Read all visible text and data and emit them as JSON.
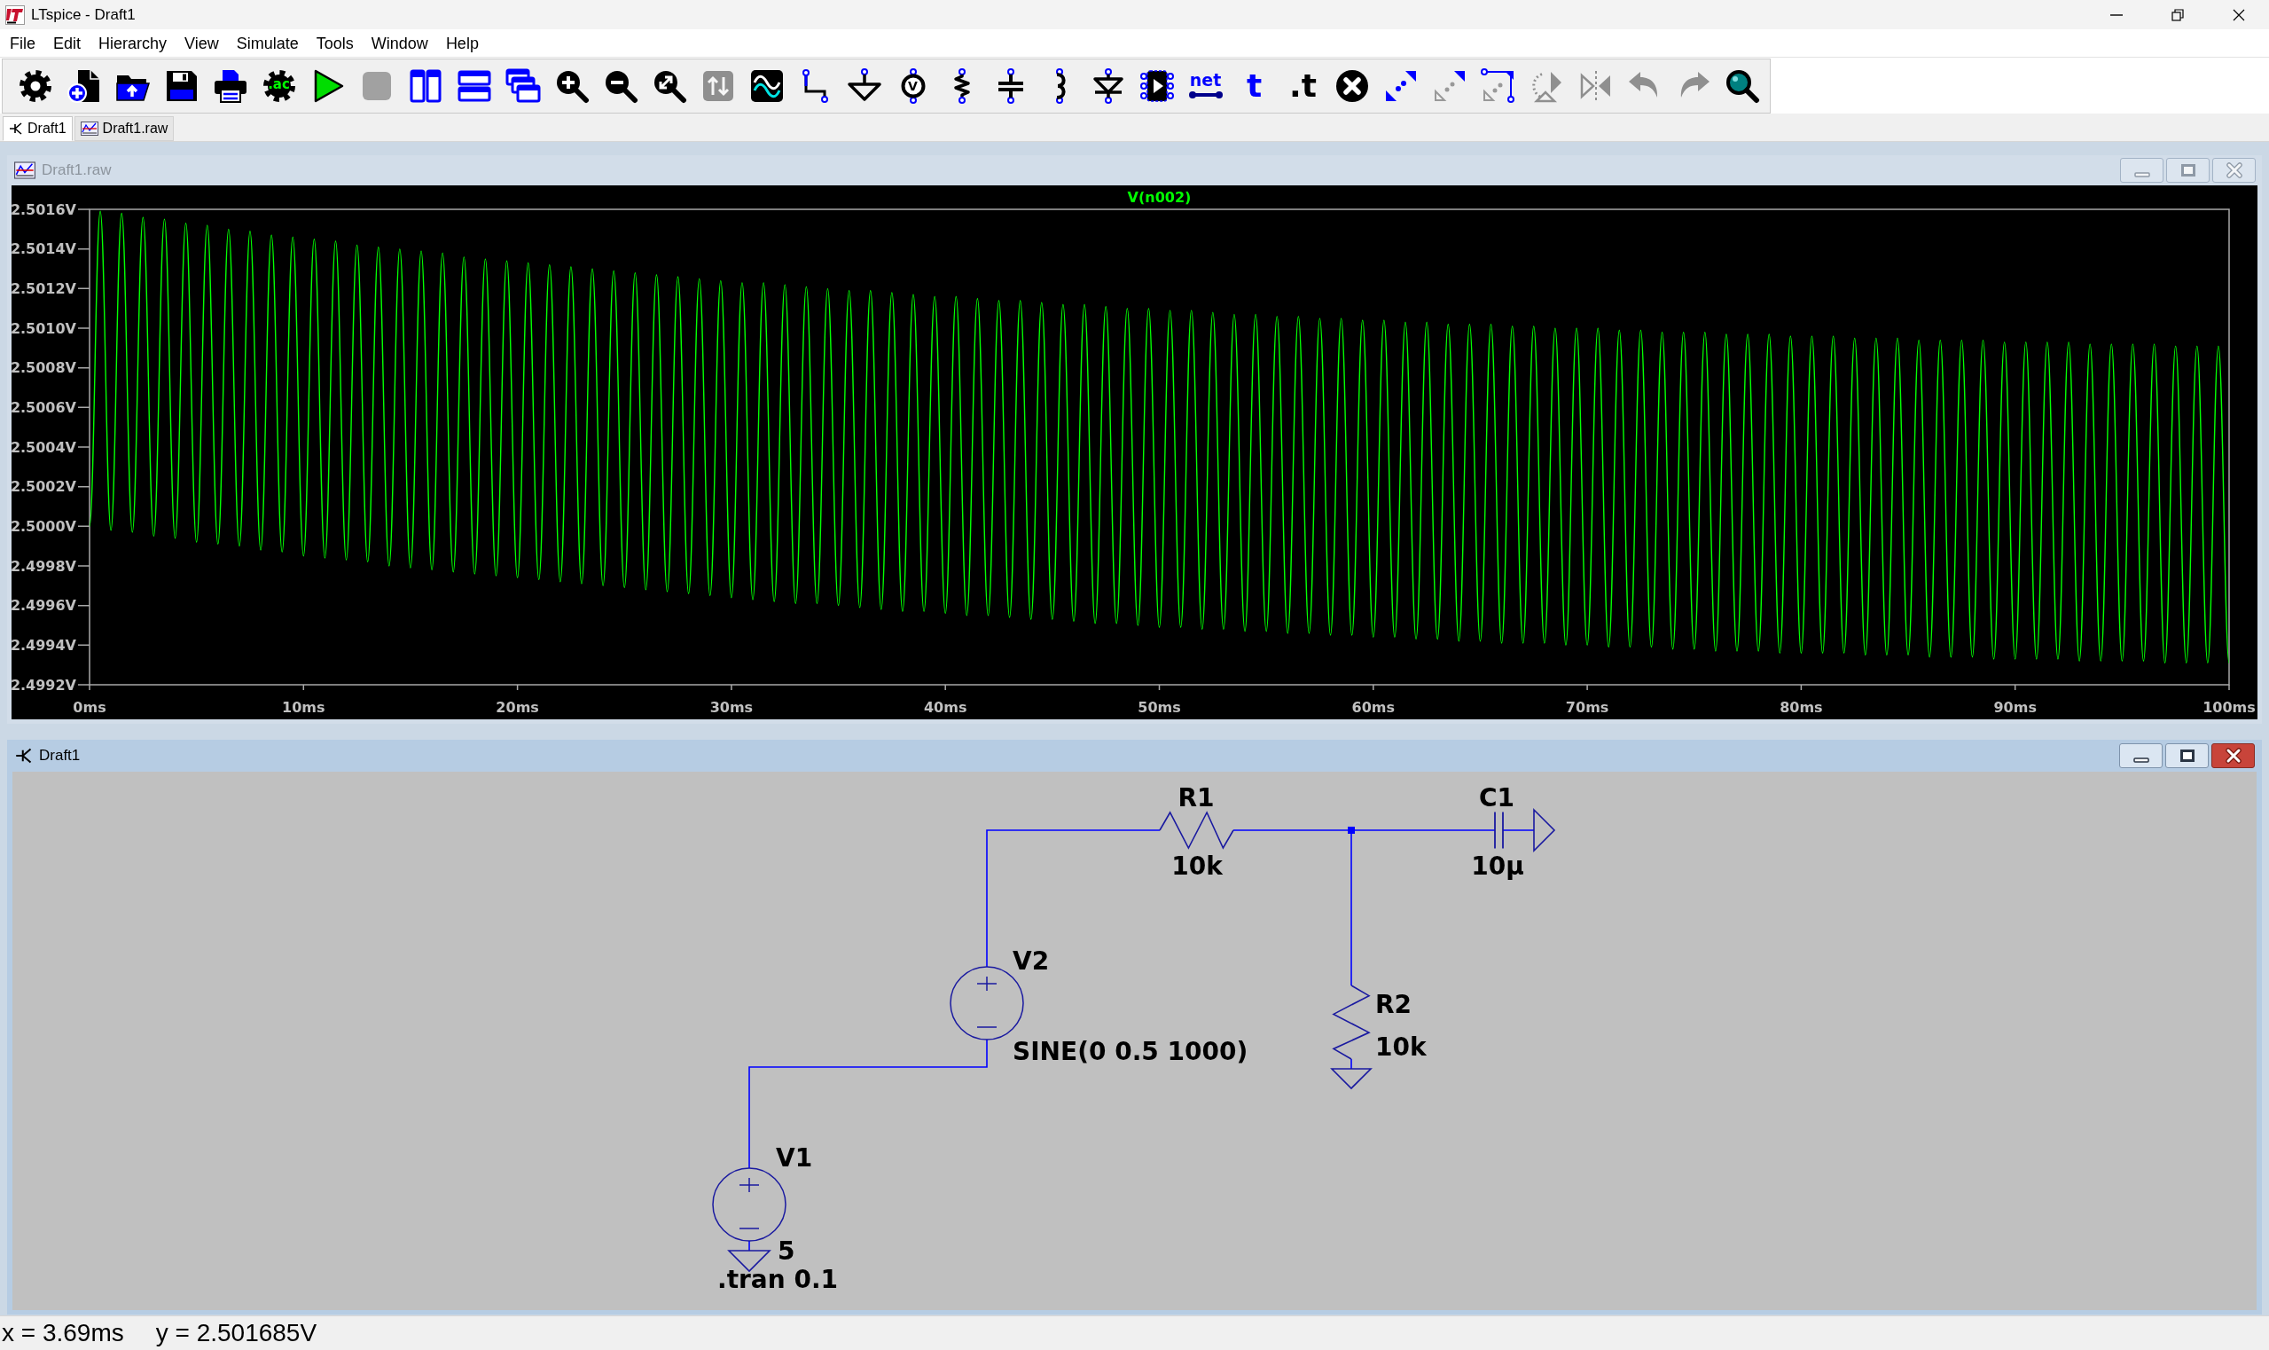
{
  "window": {
    "title": "LTspice - Draft1"
  },
  "menu": [
    "File",
    "Edit",
    "Hierarchy",
    "View",
    "Simulate",
    "Tools",
    "Window",
    "Help"
  ],
  "toolbar": [
    {
      "kind": "settings",
      "disabled": false
    },
    {
      "kind": "new",
      "disabled": false
    },
    {
      "kind": "open",
      "disabled": false
    },
    {
      "kind": "save",
      "disabled": false
    },
    {
      "kind": "print",
      "disabled": false
    },
    {
      "kind": "ac",
      "text": ".ac",
      "disabled": false
    },
    {
      "kind": "run",
      "disabled": false
    },
    {
      "kind": "stop",
      "disabled": true
    },
    {
      "kind": "tile_columns",
      "disabled": false
    },
    {
      "kind": "tile_rows",
      "disabled": false
    },
    {
      "kind": "cascade",
      "disabled": false
    },
    {
      "kind": "zoom_in",
      "disabled": false
    },
    {
      "kind": "zoom_out",
      "disabled": false
    },
    {
      "kind": "zoom_fit",
      "disabled": false
    },
    {
      "kind": "pan",
      "disabled": true
    },
    {
      "kind": "waveform",
      "disabled": false
    },
    {
      "kind": "wire",
      "disabled": false
    },
    {
      "kind": "ground",
      "disabled": false
    },
    {
      "kind": "voltage_source",
      "text": "V",
      "disabled": false
    },
    {
      "kind": "resistor",
      "disabled": false
    },
    {
      "kind": "capacitor",
      "disabled": false
    },
    {
      "kind": "inductor",
      "disabled": false
    },
    {
      "kind": "diode",
      "disabled": false
    },
    {
      "kind": "component",
      "disabled": false
    },
    {
      "kind": "net",
      "text": "net",
      "disabled": false
    },
    {
      "kind": "text",
      "text": "t",
      "disabled": false
    },
    {
      "kind": "spice",
      "text": ".t",
      "disabled": false
    },
    {
      "kind": "delete",
      "disabled": false
    },
    {
      "kind": "copy",
      "disabled": false
    },
    {
      "kind": "move",
      "disabled": false
    },
    {
      "kind": "drag",
      "disabled": false
    },
    {
      "kind": "rotate",
      "disabled": true
    },
    {
      "kind": "mirror",
      "disabled": true
    },
    {
      "kind": "undo",
      "disabled": true
    },
    {
      "kind": "redo",
      "disabled": true
    },
    {
      "kind": "find",
      "disabled": false
    }
  ],
  "tabs": [
    {
      "label": "Draft1",
      "kind": "schematic",
      "selected": true
    },
    {
      "label": "Draft1.raw",
      "kind": "waveform",
      "selected": false
    }
  ],
  "plot_window": {
    "title": "Draft1.raw",
    "active": false,
    "chart_data": {
      "type": "line",
      "xlim": [
        0,
        100
      ],
      "ylim": [
        2.4992,
        2.5016
      ],
      "xticks": [
        {
          "value": 0,
          "label": "0ms"
        },
        {
          "value": 10,
          "label": "10ms"
        },
        {
          "value": 20,
          "label": "20ms"
        },
        {
          "value": 30,
          "label": "30ms"
        },
        {
          "value": 40,
          "label": "40ms"
        },
        {
          "value": 50,
          "label": "50ms"
        },
        {
          "value": 60,
          "label": "60ms"
        },
        {
          "value": 70,
          "label": "70ms"
        },
        {
          "value": 80,
          "label": "80ms"
        },
        {
          "value": 90,
          "label": "90ms"
        },
        {
          "value": 100,
          "label": "100ms"
        }
      ],
      "yticks": [
        {
          "value": 2.5016,
          "label": "2.5016V"
        },
        {
          "value": 2.5014,
          "label": "2.5014V"
        },
        {
          "value": 2.5012,
          "label": "2.5012V"
        },
        {
          "value": 2.501,
          "label": "2.5010V"
        },
        {
          "value": 2.5008,
          "label": "2.5008V"
        },
        {
          "value": 2.5006,
          "label": "2.5006V"
        },
        {
          "value": 2.5004,
          "label": "2.5004V"
        },
        {
          "value": 2.5002,
          "label": "2.5002V"
        },
        {
          "value": 2.5,
          "label": "2.5000V"
        },
        {
          "value": 2.4998,
          "label": "2.4998V"
        },
        {
          "value": 2.4996,
          "label": "2.4996V"
        },
        {
          "value": 2.4994,
          "label": "2.4994V"
        },
        {
          "value": 2.4992,
          "label": "2.4992V"
        }
      ],
      "x": [
        0,
        0.5,
        1,
        1.5,
        2,
        2.5,
        3,
        3.5,
        4,
        4.5,
        5,
        5.5,
        6,
        6.5,
        7,
        7.5,
        8,
        8.5,
        9,
        9.5,
        10,
        10.5,
        11,
        11.5,
        12,
        12.5,
        13,
        13.5,
        14,
        14.5,
        15,
        15.5,
        16,
        16.5,
        17,
        17.5,
        18,
        18.5,
        19,
        19.5,
        20,
        20.5,
        21,
        21.5,
        22,
        22.5,
        23,
        23.5,
        24,
        24.5,
        25,
        25.5,
        26,
        26.5,
        27,
        27.5,
        28,
        28.5,
        29,
        29.5,
        30,
        30.5,
        31,
        31.5,
        32,
        32.5,
        33,
        33.5,
        34,
        34.5,
        35,
        35.5,
        36,
        36.5,
        37,
        37.5,
        38,
        38.5,
        39,
        39.5,
        40,
        40.5,
        41,
        41.5,
        42,
        42.5,
        43,
        43.5,
        44,
        44.5,
        45,
        45.5,
        46,
        46.5,
        47,
        47.5,
        48,
        48.5,
        49,
        49.5,
        50,
        50.5,
        51,
        51.5,
        52,
        52.5,
        53,
        53.5,
        54,
        54.5,
        55,
        55.5,
        56,
        56.5,
        57,
        57.5,
        58,
        58.5,
        59,
        59.5,
        60,
        60.5,
        61,
        61.5,
        62,
        62.5,
        63,
        63.5,
        64,
        64.5,
        65,
        65.5,
        66,
        66.5,
        67,
        67.5,
        68,
        68.5,
        69,
        69.5,
        70,
        70.5,
        71,
        71.5,
        72,
        72.5,
        73,
        73.5,
        74,
        74.5,
        75,
        75.5,
        76,
        76.5,
        77,
        77.5,
        78,
        78.5,
        79,
        79.5,
        80,
        80.5,
        81,
        81.5,
        82,
        82.5,
        83,
        83.5,
        84,
        84.5,
        85,
        85.5,
        86,
        86.5,
        87,
        87.5,
        88,
        88.5,
        89,
        89.5,
        90,
        90.5,
        91,
        91.5,
        92,
        92.5,
        93,
        93.5,
        94,
        94.5,
        95,
        95.5,
        96,
        96.5,
        97,
        97.5,
        98,
        98.5,
        99,
        99.5,
        100
      ],
      "series": [
        {
          "name": "V(n002)",
          "color": "#00ff00",
          "values": [
            2.5,
            2.50159,
            2.49998,
            2.50158,
            2.49997,
            2.50156,
            2.49995,
            2.50155,
            2.49994,
            2.50153,
            2.49992,
            2.50152,
            2.49991,
            2.5015,
            2.4999,
            2.50149,
            2.49988,
            2.50147,
            2.49987,
            2.50146,
            2.49985,
            2.50145,
            2.49984,
            2.50144,
            2.49983,
            2.50142,
            2.49982,
            2.50141,
            2.4998,
            2.5014,
            2.49979,
            2.50139,
            2.49978,
            2.50138,
            2.49977,
            2.50136,
            2.49976,
            2.50135,
            2.49975,
            2.50134,
            2.49974,
            2.50133,
            2.49973,
            2.50132,
            2.49972,
            2.50131,
            2.49971,
            2.5013,
            2.4997,
            2.50129,
            2.49969,
            2.50128,
            2.49968,
            2.50127,
            2.49967,
            2.50126,
            2.49966,
            2.50125,
            2.49965,
            2.50124,
            2.49964,
            2.50123,
            2.49963,
            2.50123,
            2.49962,
            2.50122,
            2.49961,
            2.50121,
            2.49961,
            2.5012,
            2.4996,
            2.50119,
            2.49959,
            2.50119,
            2.49958,
            2.50118,
            2.49957,
            2.50117,
            2.49957,
            2.50116,
            2.49956,
            2.50116,
            2.49955,
            2.50115,
            2.49955,
            2.50114,
            2.49954,
            2.50114,
            2.49953,
            2.50113,
            2.49953,
            2.50112,
            2.49952,
            2.50112,
            2.49951,
            2.50111,
            2.49951,
            2.5011,
            2.4995,
            2.5011,
            2.49949,
            2.50109,
            2.49949,
            2.50109,
            2.49948,
            2.50108,
            2.49948,
            2.50107,
            2.49947,
            2.50107,
            2.49947,
            2.50106,
            2.49946,
            2.50106,
            2.49946,
            2.50105,
            2.49945,
            2.50105,
            2.49945,
            2.50104,
            2.49944,
            2.50104,
            2.49944,
            2.50103,
            2.49943,
            2.50103,
            2.49943,
            2.50102,
            2.49942,
            2.50102,
            2.49942,
            2.50102,
            2.49941,
            2.50101,
            2.49941,
            2.50101,
            2.49941,
            2.501,
            2.4994,
            2.501,
            2.4994,
            2.501,
            2.49939,
            2.50099,
            2.49939,
            2.50099,
            2.49939,
            2.50098,
            2.49938,
            2.50098,
            2.49938,
            2.50098,
            2.49937,
            2.50097,
            2.49937,
            2.50097,
            2.49937,
            2.50097,
            2.49936,
            2.50096,
            2.49936,
            2.50096,
            2.49936,
            2.50096,
            2.49936,
            2.50095,
            2.49935,
            2.50095,
            2.49935,
            2.50095,
            2.49935,
            2.50094,
            2.49934,
            2.50094,
            2.49934,
            2.50094,
            2.49934,
            2.50094,
            2.49933,
            2.50093,
            2.49933,
            2.50093,
            2.49933,
            2.50093,
            2.49933,
            2.50093,
            2.49932,
            2.50092,
            2.49932,
            2.50092,
            2.49932,
            2.50092,
            2.49932,
            2.50092,
            2.49931,
            2.50091,
            2.49931,
            2.50091,
            2.49931,
            2.50091,
            2.49931
          ]
        }
      ]
    }
  },
  "schematic_window": {
    "title": "Draft1",
    "active": true,
    "components": [
      {
        "kind": "resistor",
        "name": "R1",
        "value": "10k"
      },
      {
        "kind": "capacitor",
        "name": "C1",
        "value": "10μ"
      },
      {
        "kind": "voltage_source",
        "name": "V2",
        "value": "SINE(0 0.5 1000)"
      },
      {
        "kind": "resistor",
        "name": "R2",
        "value": "10k"
      },
      {
        "kind": "voltage_source",
        "name": "V1",
        "value": "5"
      }
    ],
    "directives": [
      ".tran 0.1"
    ]
  },
  "status_bar": {
    "x_reading": "x = 3.69ms",
    "y_reading": "y = 2.501685V"
  }
}
